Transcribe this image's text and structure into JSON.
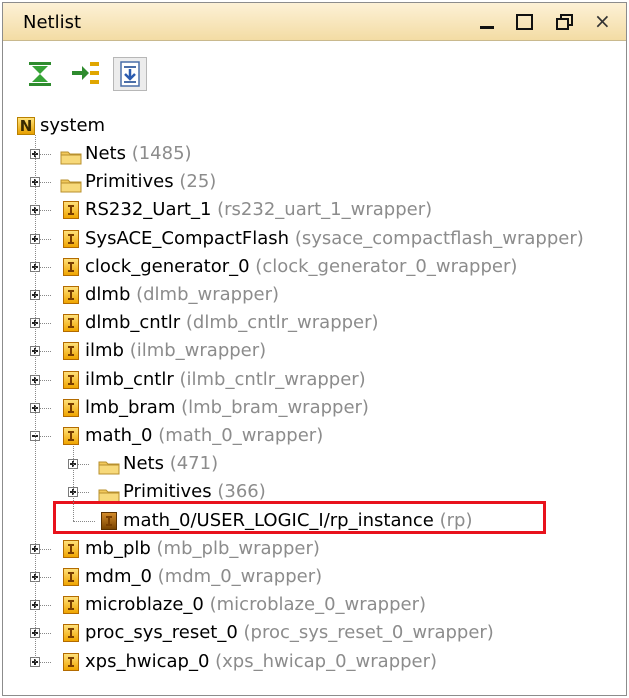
{
  "panel": {
    "title": "Netlist",
    "window_buttons": [
      "minimize-icon",
      "maximize-icon",
      "restore-icon",
      "close-icon"
    ],
    "close_glyph": "×"
  },
  "toolbar": {
    "buttons": [
      "collapse-all-icon",
      "expand-icon",
      "show-source-icon"
    ],
    "active_index": 2
  },
  "tree": {
    "root": {
      "label": "system",
      "icon": "N"
    },
    "items": [
      {
        "label": "Nets",
        "hint": "(1485)",
        "type": "folder",
        "level": 1,
        "expanded": false
      },
      {
        "label": "Primitives",
        "hint": "(25)",
        "type": "folder",
        "level": 1,
        "expanded": false
      },
      {
        "label": "RS232_Uart_1",
        "hint": "(rs232_uart_1_wrapper)",
        "type": "instance",
        "level": 1,
        "expanded": false
      },
      {
        "label": "SysACE_CompactFlash",
        "hint": "(sysace_compactflash_wrapper)",
        "type": "instance",
        "level": 1,
        "expanded": false
      },
      {
        "label": "clock_generator_0",
        "hint": "(clock_generator_0_wrapper)",
        "type": "instance",
        "level": 1,
        "expanded": false
      },
      {
        "label": "dlmb",
        "hint": "(dlmb_wrapper)",
        "type": "instance",
        "level": 1,
        "expanded": false
      },
      {
        "label": "dlmb_cntlr",
        "hint": "(dlmb_cntlr_wrapper)",
        "type": "instance",
        "level": 1,
        "expanded": false
      },
      {
        "label": "ilmb",
        "hint": "(ilmb_wrapper)",
        "type": "instance",
        "level": 1,
        "expanded": false
      },
      {
        "label": "ilmb_cntlr",
        "hint": "(ilmb_cntlr_wrapper)",
        "type": "instance",
        "level": 1,
        "expanded": false
      },
      {
        "label": "lmb_bram",
        "hint": "(lmb_bram_wrapper)",
        "type": "instance",
        "level": 1,
        "expanded": false
      },
      {
        "label": "math_0",
        "hint": "(math_0_wrapper)",
        "type": "instance",
        "level": 1,
        "expanded": true
      },
      {
        "label": "Nets",
        "hint": "(471)",
        "type": "folder",
        "level": 2,
        "expanded": false
      },
      {
        "label": "Primitives",
        "hint": "(366)",
        "type": "folder",
        "level": 2,
        "expanded": false
      },
      {
        "label": "math_0/USER_LOGIC_I/rp_instance",
        "hint": "(rp)",
        "type": "instance-dark",
        "level": 2,
        "leaf": true,
        "highlighted": true
      },
      {
        "label": "mb_plb",
        "hint": "(mb_plb_wrapper)",
        "type": "instance",
        "level": 1,
        "expanded": false
      },
      {
        "label": "mdm_0",
        "hint": "(mdm_0_wrapper)",
        "type": "instance",
        "level": 1,
        "expanded": false
      },
      {
        "label": "microblaze_0",
        "hint": "(microblaze_0_wrapper)",
        "type": "instance",
        "level": 1,
        "expanded": false
      },
      {
        "label": "proc_sys_reset_0",
        "hint": "(proc_sys_reset_0_wrapper)",
        "type": "instance",
        "level": 1,
        "expanded": false
      },
      {
        "label": "xps_hwicap_0",
        "hint": "(xps_hwicap_0_wrapper)",
        "type": "instance",
        "level": 1,
        "expanded": false
      }
    ]
  },
  "colors": {
    "hint_text": "#8c8c8c",
    "highlight_border": "#e8121c",
    "folder": "#f2c95c"
  }
}
